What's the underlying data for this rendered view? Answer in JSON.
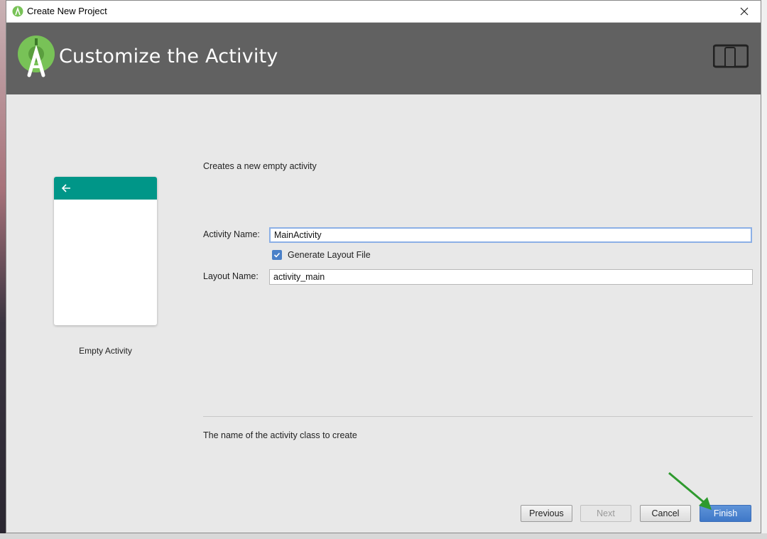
{
  "window": {
    "title": "Create New Project"
  },
  "header": {
    "heading": "Customize the Activity"
  },
  "preview": {
    "label": "Empty Activity",
    "appbar_color": "#009688"
  },
  "form": {
    "description": "Creates a new empty activity",
    "activity_name_label": "Activity Name:",
    "activity_name_value": "MainActivity",
    "generate_layout_label": "Generate Layout File",
    "generate_layout_checked": true,
    "layout_name_label": "Layout Name:",
    "layout_name_value": "activity_main",
    "hint": "The name of the activity class to create"
  },
  "buttons": {
    "previous": "Previous",
    "next": "Next",
    "cancel": "Cancel",
    "finish": "Finish"
  },
  "colors": {
    "header_bg": "#616161",
    "accent": "#4a80c8",
    "android_green": "#78c257",
    "arrow_green": "#2e9a2e"
  },
  "icons": [
    "android-studio-icon",
    "close-icon",
    "device-icon",
    "back-arrow-icon",
    "checkmark-icon"
  ]
}
